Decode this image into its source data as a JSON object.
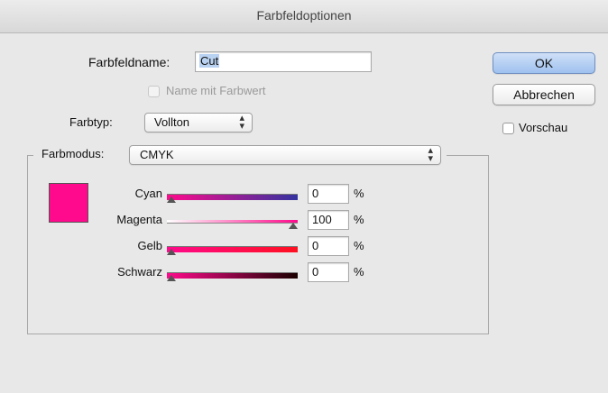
{
  "window": {
    "title": "Farbfeldoptionen"
  },
  "swatch_name": {
    "label": "Farbfeldname:",
    "value": "Cut"
  },
  "name_with_value": {
    "label": "Name mit Farbwert",
    "checked": false,
    "enabled": false
  },
  "color_type": {
    "label": "Farbtyp:",
    "value": "Vollton"
  },
  "color_mode": {
    "label": "Farbmodus:",
    "value": "CMYK"
  },
  "buttons": {
    "ok": "OK",
    "cancel": "Abbrechen"
  },
  "preview": {
    "label": "Vorschau",
    "checked": false
  },
  "swatch_color": "#ff0a8c",
  "unit": "%",
  "channels": [
    {
      "label": "Cyan",
      "value": "0",
      "gradient_from": "#ff0a8c",
      "gradient_to": "#3333a0"
    },
    {
      "label": "Magenta",
      "value": "100",
      "gradient_from": "#ffffff",
      "gradient_to": "#ff0a8c"
    },
    {
      "label": "Gelb",
      "value": "0",
      "gradient_from": "#ff0a8c",
      "gradient_to": "#ff1020"
    },
    {
      "label": "Schwarz",
      "value": "0",
      "gradient_from": "#ff0a8c",
      "gradient_to": "#1a0000"
    }
  ]
}
